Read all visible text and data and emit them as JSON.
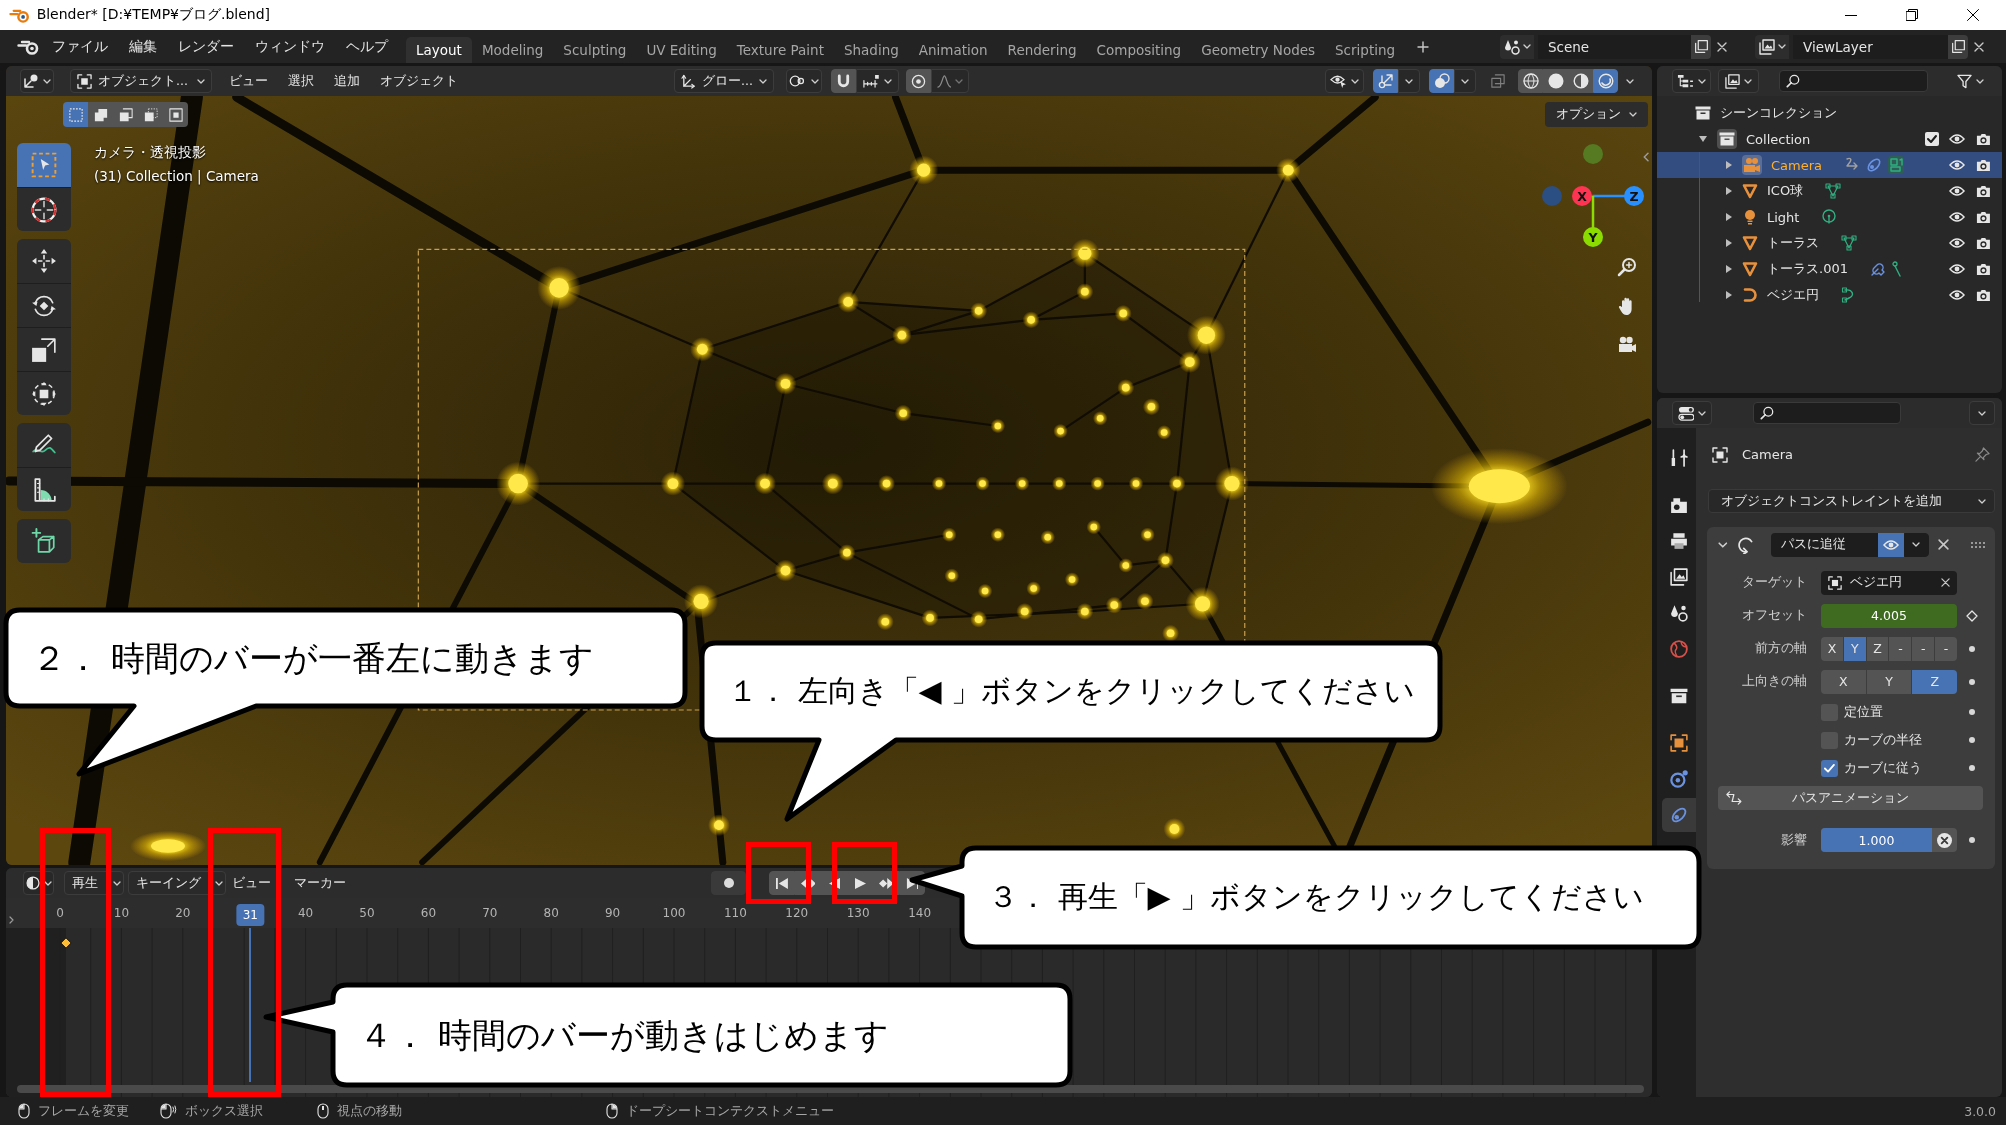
{
  "window": {
    "title": "Blender* [D:¥TEMP¥ブログ.blend]"
  },
  "menu_bar": [
    "ファイル",
    "編集",
    "レンダー",
    "ウィンドウ",
    "ヘルプ"
  ],
  "workspace_tabs": [
    {
      "label": "Layout",
      "selected": true
    },
    {
      "label": "Modeling",
      "selected": false
    },
    {
      "label": "Sculpting",
      "selected": false
    },
    {
      "label": "UV Editing",
      "selected": false
    },
    {
      "label": "Texture Paint",
      "selected": false
    },
    {
      "label": "Shading",
      "selected": false
    },
    {
      "label": "Animation",
      "selected": false
    },
    {
      "label": "Rendering",
      "selected": false
    },
    {
      "label": "Compositing",
      "selected": false
    },
    {
      "label": "Geometry Nodes",
      "selected": false
    },
    {
      "label": "Scripting",
      "selected": false
    }
  ],
  "scene": "Scene",
  "view_layer": "ViewLayer",
  "viewport": {
    "mode": "オブジェクト...",
    "menus": [
      "ビュー",
      "選択",
      "追加",
      "オブジェクト"
    ],
    "orientation": "グロー...",
    "snap": false,
    "proportional": false,
    "gizmos": true,
    "overlays": true,
    "xray": false,
    "shading": [
      {
        "kind": "wireframe",
        "selected": false
      },
      {
        "kind": "solid",
        "selected": false
      },
      {
        "kind": "material",
        "selected": false
      },
      {
        "kind": "rendered",
        "selected": true
      }
    ],
    "select_modes": [
      {
        "kind": "set",
        "selected": true
      },
      {
        "kind": "extend",
        "selected": false
      },
      {
        "kind": "subtract",
        "selected": false
      },
      {
        "kind": "invert",
        "selected": false
      },
      {
        "kind": "intersect",
        "selected": false
      }
    ],
    "options": "オプション",
    "info": [
      "カメラ・透視投影",
      "(31) Collection | Camera"
    ],
    "tools": [
      {
        "kind": "select_box",
        "selected": true
      },
      {
        "kind": "cursor",
        "selected": false
      },
      {
        "kind": "move",
        "selected": false
      },
      {
        "kind": "rotate",
        "selected": false
      },
      {
        "kind": "scale",
        "selected": false
      },
      {
        "kind": "transform",
        "selected": false
      },
      {
        "kind": "annotate",
        "selected": false
      },
      {
        "kind": "measure",
        "selected": false
      },
      {
        "kind": "add_cube",
        "selected": false
      }
    ],
    "gizmo": [
      {
        "kind": "negative",
        "color": "#557a22"
      },
      {
        "kind": "negative",
        "color": "#2b4f82"
      },
      {
        "kind": "axis",
        "label": "X",
        "color": "#ff3352"
      },
      {
        "kind": "axis",
        "label": "Z",
        "color": "#2890ff"
      },
      {
        "kind": "axis",
        "label": "Y",
        "color": "#8bdc00"
      }
    ]
  },
  "timeline": {
    "menus": [
      {
        "kind": "dropdown",
        "label": "再生"
      },
      {
        "kind": "dropdown",
        "label": "キーイング"
      },
      {
        "kind": "menu",
        "label": "ビュー"
      },
      {
        "kind": "menu",
        "label": "マーカー"
      }
    ],
    "auto_keying": false,
    "playback": [
      {
        "kind": "jump_start"
      },
      {
        "kind": "prev_keyframe"
      },
      {
        "kind": "play_reverse"
      },
      {
        "kind": "play"
      },
      {
        "kind": "next_keyframe"
      },
      {
        "kind": "jump_end"
      }
    ],
    "ruler": [
      "0",
      "10",
      "20",
      "40",
      "50",
      "60",
      "70",
      "80",
      "90",
      "100",
      "110",
      "120",
      "130",
      "140"
    ],
    "current_frame": "31"
  },
  "outliner": {
    "tree": [
      {
        "label": "シーンコレクション",
        "kind": "scene_collection",
        "selected": false,
        "children": [
          {
            "label": "Collection",
            "kind": "collection",
            "selected": false,
            "expanded": true,
            "checked": true,
            "visible": true,
            "renderable": true,
            "children": [
              {
                "label": "Camera",
                "kind": "camera",
                "selected": true,
                "expanded": false,
                "constraints": true,
                "modifiers": false,
                "visible": true,
                "renderable": true
              },
              {
                "label": "ICO球",
                "kind": "mesh",
                "selected": false,
                "expanded": false,
                "constraints": false,
                "modifiers": false,
                "visible": true,
                "renderable": true
              },
              {
                "label": "Light",
                "kind": "light",
                "selected": false,
                "expanded": false,
                "constraints": false,
                "modifiers": false,
                "visible": true,
                "renderable": true
              },
              {
                "label": "トーラス",
                "kind": "mesh",
                "selected": false,
                "expanded": false,
                "constraints": false,
                "modifiers": false,
                "visible": true,
                "renderable": true
              },
              {
                "label": "トーラス.001",
                "kind": "mesh",
                "selected": false,
                "expanded": false,
                "constraints": false,
                "modifiers": true,
                "visible": true,
                "renderable": true
              },
              {
                "label": "ベジエ円",
                "kind": "curve",
                "selected": false,
                "expanded": false,
                "constraints": false,
                "modifiers": false,
                "visible": true,
                "renderable": true
              }
            ]
          }
        ]
      }
    ]
  },
  "properties": {
    "tabs": [
      {
        "kind": "tool",
        "selected": false
      },
      {
        "kind": "render",
        "selected": false
      },
      {
        "kind": "output",
        "selected": false
      },
      {
        "kind": "view_layer",
        "selected": false
      },
      {
        "kind": "scene",
        "selected": false
      },
      {
        "kind": "world",
        "selected": false
      },
      {
        "kind": "collection",
        "selected": false
      },
      {
        "kind": "object",
        "selected": false
      },
      {
        "kind": "physics",
        "selected": false
      },
      {
        "kind": "constraints",
        "selected": true
      }
    ],
    "object": "Camera",
    "add_menu": "オブジェクトコンストレイントを追加",
    "constraint": {
      "name": "パスに追従",
      "expanded": true,
      "enabled": true,
      "rows": [
        {
          "kind": "object",
          "label": "ターゲット",
          "value": "ベジエ円"
        },
        {
          "kind": "number",
          "label": "オフセット",
          "value": "4.005",
          "animated": true
        },
        {
          "kind": "axis",
          "label": "前方の軸",
          "options": [
            {
              "label": "X",
              "selected": false
            },
            {
              "label": "Y",
              "selected": true
            },
            {
              "label": "Z",
              "selected": false
            },
            {
              "label": "-",
              "selected": false
            },
            {
              "label": "-",
              "selected": false
            },
            {
              "label": "-",
              "selected": false
            }
          ]
        },
        {
          "kind": "axis",
          "label": "上向きの軸",
          "options": [
            {
              "label": "X",
              "selected": false
            },
            {
              "label": "Y",
              "selected": false
            },
            {
              "label": "Z",
              "selected": true
            }
          ]
        },
        {
          "kind": "checkbox",
          "label": "定位置",
          "checked": false
        },
        {
          "kind": "checkbox",
          "label": "カーブの半径",
          "checked": false
        },
        {
          "kind": "checkbox",
          "label": "カーブに従う",
          "checked": true
        },
        {
          "kind": "button",
          "label": "パスアニメーション"
        },
        {
          "kind": "slider",
          "label": "影響",
          "value": "1.000",
          "level": 1
        }
      ]
    }
  },
  "status_bar": {
    "hints": [
      {
        "kind": "left_click",
        "label": "フレームを変更"
      },
      {
        "kind": "left_drag",
        "label": "ボックス選択"
      },
      {
        "kind": "middle_click",
        "label": "視点の移動"
      },
      {
        "kind": "right_click",
        "label": "ドープシートコンテクストメニュー"
      }
    ],
    "version": "3.0.0"
  },
  "callouts": [
    {
      "text": "１． 左向き「◀ 」ボタンをクリックしてください"
    },
    {
      "text": "２． 時間のバーが一番左に動きます"
    },
    {
      "text": "３． 再生「▶ 」ボタンをクリックしてください"
    },
    {
      "text": "４． 時間のバーが動きはじめます"
    }
  ]
}
